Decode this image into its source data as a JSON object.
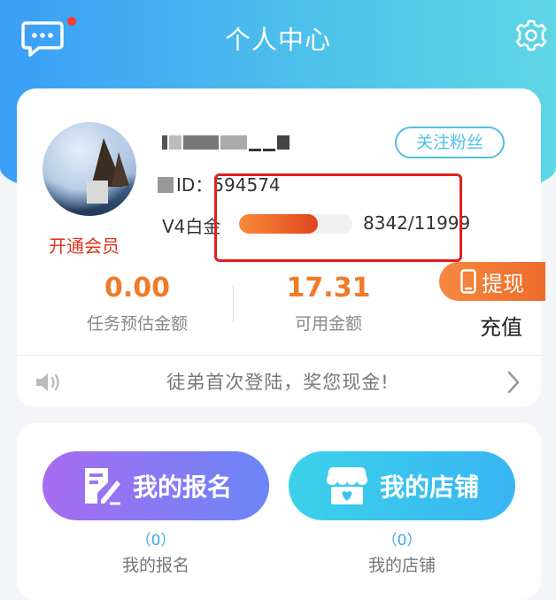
{
  "header": {
    "title": "个人中心",
    "left_icon": "chat-bubble-icon",
    "right_icon": "gear-icon",
    "unread_dot": true
  },
  "profile": {
    "vip_link": "开通会员",
    "uid_label": "ID：",
    "uid_value": "594574",
    "follow_button": "关注粉丝",
    "level_label": "V4白金",
    "level_progress_fraction": 0.695,
    "level_progress_text": "8342/11999"
  },
  "actions": {
    "withdraw": "提现",
    "recharge": "充值"
  },
  "stats": [
    {
      "value": "0.00",
      "label": "任务预估金额"
    },
    {
      "value": "17.31",
      "label": "可用金额"
    }
  ],
  "notice": {
    "text": "徒弟首次登陆，奖您现金!"
  },
  "features": [
    {
      "button": "我的报名",
      "count": "（0）",
      "label": "我的报名"
    },
    {
      "button": "我的店铺",
      "count": "（0）",
      "label": "我的店铺"
    }
  ],
  "colors": {
    "accent_orange": "#f07a26",
    "header_blue": "#3a9ef7",
    "highlight_red": "#e01f1f",
    "vip_red": "#e0321e"
  }
}
